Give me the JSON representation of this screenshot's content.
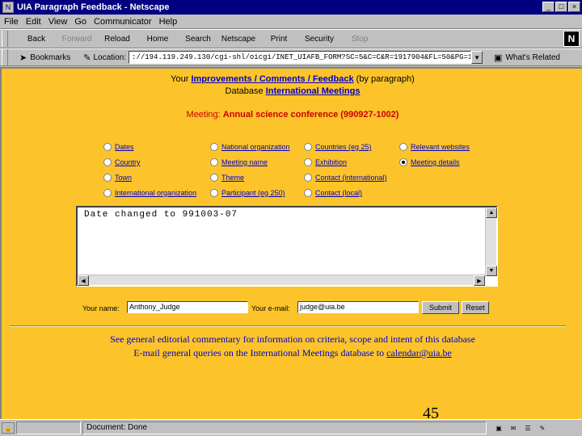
{
  "window": {
    "title": "UIA Paragraph Feedback - Netscape"
  },
  "menu": [
    "File",
    "Edit",
    "View",
    "Go",
    "Communicator",
    "Help"
  ],
  "toolbar": [
    {
      "label": "Back",
      "icon": "back-arrow-icon",
      "enabled": true
    },
    {
      "label": "Forward",
      "icon": "forward-arrow-icon",
      "enabled": false
    },
    {
      "label": "Reload",
      "icon": "reload-icon",
      "enabled": true
    },
    {
      "label": "Home",
      "icon": "home-icon",
      "enabled": true
    },
    {
      "label": "Search",
      "icon": "search-icon",
      "enabled": true
    },
    {
      "label": "Netscape",
      "icon": "netscape-icon",
      "enabled": true
    },
    {
      "label": "Print",
      "icon": "print-icon",
      "enabled": true
    },
    {
      "label": "Security",
      "icon": "lock-icon",
      "enabled": true
    },
    {
      "label": "Stop",
      "icon": "stop-icon",
      "enabled": false
    }
  ],
  "location": {
    "bookmarks_label": "Bookmarks",
    "location_label": "Location:",
    "url": "://194.119.249.130/cgi-shl/oicgi/INET_UIAFB_FORM?SC=5&C=C&R=1917904&FL=50&PG=1&",
    "whats_related": "What's Related"
  },
  "page": {
    "header_prefix": "Your",
    "header_link": "Improvements / Comments / Feedback",
    "header_suffix": "(by paragraph)",
    "db_label": "Database",
    "db_link": "International Meetings",
    "meeting_label": "Meeting:",
    "meeting_value": "Annual science conference (990927-1002)",
    "radio_options": [
      {
        "label": "Dates",
        "checked": false
      },
      {
        "label": "Country",
        "checked": false
      },
      {
        "label": "Town",
        "checked": false
      },
      {
        "label": "International organization",
        "checked": false
      },
      {
        "label": "National organization",
        "checked": false
      },
      {
        "label": "Meeting name",
        "checked": false
      },
      {
        "label": "Theme",
        "checked": false
      },
      {
        "label": "Participant (eg 250)",
        "checked": false
      },
      {
        "label": "Countries (eg 25)",
        "checked": false
      },
      {
        "label": "Exhibition",
        "checked": false
      },
      {
        "label": "Contact (international)",
        "checked": false
      },
      {
        "label": "Contact (local)",
        "checked": false
      },
      {
        "label": "Relevant websites",
        "checked": false
      },
      {
        "label": "Meeting details",
        "checked": true
      }
    ],
    "comment_text": "Date changed to 991003-07",
    "name_label": "Your name:",
    "name_value": "Anthony_Judge",
    "email_label": "Your e-mail:",
    "email_value": "judge@uia.be",
    "submit_label": "Submit",
    "reset_label": "Reset",
    "footer_line1": "See general editorial commentary for information on criteria, scope and intent of this database",
    "footer_line2_prefix": "E-mail general queries on the International Meetings database to",
    "footer_email": "calendar@uia.be",
    "page_number": "45"
  },
  "status": {
    "text": "Document: Done"
  },
  "colors": {
    "background": "#fcc42a",
    "title_bar": "#000080",
    "link": "#0000cc",
    "meeting": "#cc0000"
  }
}
